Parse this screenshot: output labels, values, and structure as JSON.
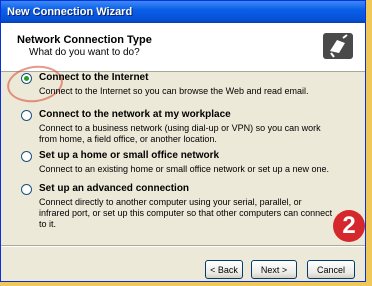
{
  "window": {
    "title": "New Connection Wizard"
  },
  "header": {
    "title": "Network Connection Type",
    "subtitle": "What do you want to do?"
  },
  "options": [
    {
      "label": "Connect to the Internet",
      "description": "Connect to the Internet so you can browse the Web and read email.",
      "checked": true
    },
    {
      "label": "Connect to the network at my workplace",
      "description": "Connect to a business network (using dial-up or VPN) so you can work from home, a field office, or another location.",
      "checked": false
    },
    {
      "label": "Set up a home or small office network",
      "description": "Connect to an existing home or small office network or set up a new one.",
      "checked": false
    },
    {
      "label": "Set up an advanced connection",
      "description": "Connect directly to another computer using your serial, parallel, or infrared port, or set up this computer so that other computers can connect to it.",
      "checked": false
    }
  ],
  "step_badge": "2",
  "buttons": {
    "back": "< Back",
    "next": "Next >",
    "cancel": "Cancel"
  }
}
